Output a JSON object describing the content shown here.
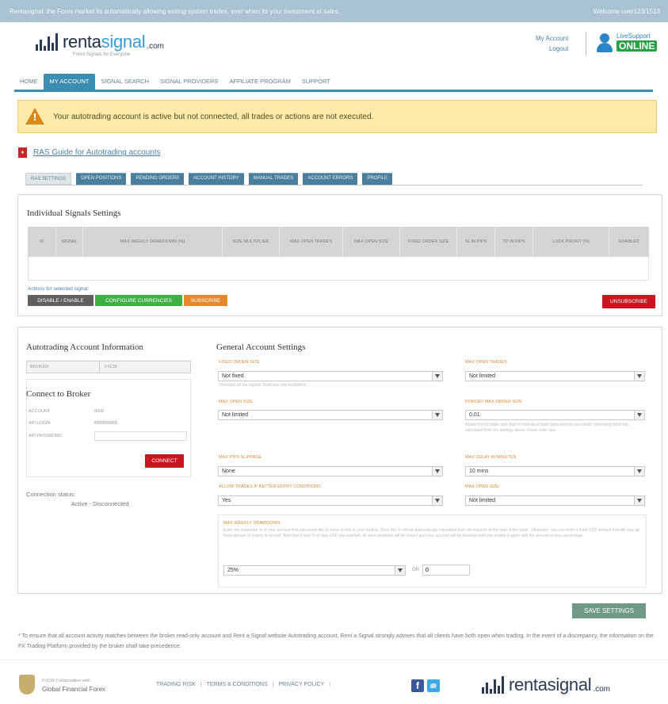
{
  "topbar": {
    "left": "Rentasignal: the Forex market its automatically allowing exiting system trades, ever when its your investment at sales.",
    "right": "Welcome user123/1513"
  },
  "brand": {
    "name_part1": "renta",
    "name_part2": "signal",
    "domain": ".com",
    "tagline": "Forex Signals for Everyone"
  },
  "account_links": {
    "my_account": "My Account",
    "logout": "Logout"
  },
  "support": {
    "top": "LiveSupport",
    "badge": "ONLINE"
  },
  "nav": [
    {
      "label": "Home"
    },
    {
      "label": "My Account"
    },
    {
      "label": "Signal Search"
    },
    {
      "label": "Signal Providers"
    },
    {
      "label": "Affiliate Program"
    },
    {
      "label": "Support"
    }
  ],
  "alert": {
    "text": "Your autotrading account is active but not connected, all trades or actions are not executed."
  },
  "guide": {
    "label": "RAS Guide for Autotrading accounts"
  },
  "subtabs": [
    "RAS Settings",
    "Open Positions",
    "Pending Orders",
    "Account History",
    "Manual Trades",
    "Account Errors",
    "Profile"
  ],
  "signals": {
    "title": "Individual Signals Settings",
    "columns": [
      "ID",
      "Signal",
      "Max Weekly Drawdown (%)",
      "Size Multiplier",
      "Max Open Trades",
      "Max Open Size",
      "Fixed Order Size",
      "SL in Pips",
      "TP in Pips",
      "Lock Profit (%)",
      "Enabled"
    ],
    "actions_label": "Actions for selected signal:",
    "buttons": {
      "enable": "Disable / Enable",
      "configure": "Configure Currencies",
      "subscribe": "Subscribe",
      "unsubscribe": "Unsubscribe"
    }
  },
  "info": {
    "title": "Autotrading Account Information",
    "broker_label": "Broker",
    "broker_value": "FXCM",
    "connect_title": "Connect to Broker",
    "fields": [
      {
        "label": "Account",
        "value": "0000"
      },
      {
        "label": "API Login",
        "value": "BBBBBBBB"
      },
      {
        "label": "API Password",
        "value": ""
      }
    ],
    "connect_btn": "Connect",
    "status_label": "Connection status:",
    "status_value": "Active - Disconnected"
  },
  "general": {
    "title": "General Account Settings",
    "fixed_order_size": {
      "label": "Fixed Order Size",
      "value": "Not fixed",
      "help": "Overrides all the signals' fixed size and multipliers."
    },
    "max_open_trades": {
      "label": "Max Open Trades",
      "value": "Not limited"
    },
    "max_open_size": {
      "label": "Max Open Size",
      "value": "Not limited"
    },
    "forced_max_order_size": {
      "label": "Forced Max Order Size",
      "value": "0.01",
      "help": "Allows you to make sure that no individual trade goes beyond your limits, overriding what was calculated from the settings above. Fixed order size."
    },
    "max_pips_slippage": {
      "label": "Max Pips Slippage",
      "value": "None"
    },
    "max_delay": {
      "label": "Max Delay in Minutes",
      "value": "10 mins"
    },
    "allow_trades": {
      "label": "Allow Trades if Better Entry Conditions",
      "value": "Yes"
    },
    "max_open_size2": {
      "label": "Max Open Size",
      "value": "Not limited"
    },
    "mwd": {
      "label": "Max Weekly Drawdown",
      "help": "Enter the maximum % of your account that you would like to loose in one or your trading. Once this % will be automatically calculated from the balance at the start of the week. Otherwise, you can enter a fixed USD amount that will stop all fixed amount of money to be lost. Note that if max % or max USD are reached, all open positions will be closed and your account will be disabled until you enable it again with the amount or less percentage.",
      "pct": "25%",
      "or": "OR",
      "amount": "0"
    },
    "save": "Save Settings"
  },
  "disclaimer": "* To ensure that all account activity matches between the broker read-only account and Rent a Signal website Autotrading account, Rent a Signal strongly advises that all clients have both open when trading. In the event of a discrepancy, the information on the FX Trading Platform provided by the broker shall take precedence.",
  "footer": {
    "fcm_top": "FXCM Collaboration with",
    "fcm_bottom": "Global Financial Forex",
    "links": [
      "TRADING RISK",
      "TERMS & CONDITIONS",
      "PRIVACY POLICY"
    ],
    "fb": "f"
  },
  "colors": {
    "nav_accent": "#3b8db1",
    "alert_bg": "#fbeaa9",
    "btn_dark": "#5f5f5f",
    "btn_green": "#3fb044",
    "btn_orange": "#e58a2c",
    "btn_red": "#c9161e",
    "save": "#6f9a86"
  }
}
